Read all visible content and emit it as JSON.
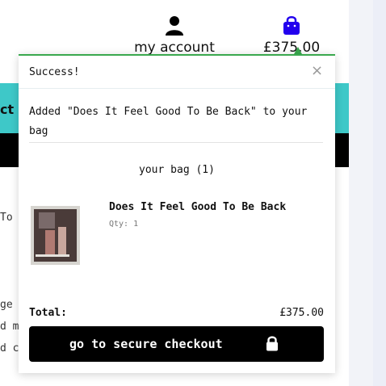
{
  "header": {
    "account_label": "my account",
    "bag_total": "£375.00"
  },
  "background": {
    "teal_text": "ct",
    "lines": [
      "To",
      "ge",
      "d m",
      "d c"
    ]
  },
  "popup": {
    "status": "Success!",
    "close_symbol": "×",
    "message": "Added \"Does It Feel Good To Be Back\" to your bag",
    "bag_heading": "your bag (1)",
    "item": {
      "title": "Does It Feel Good To Be Back",
      "qty": "Qty: 1"
    },
    "total_label": "Total:",
    "total_value": "£375.00",
    "checkout_label": "go to secure checkout"
  },
  "colors": {
    "accent_green": "#3aa84e",
    "teal": "#3ec8c8",
    "bag_icon": "#2200ee"
  },
  "icons": [
    "user-icon",
    "shopping-bag-icon",
    "close-icon",
    "lock-icon"
  ]
}
